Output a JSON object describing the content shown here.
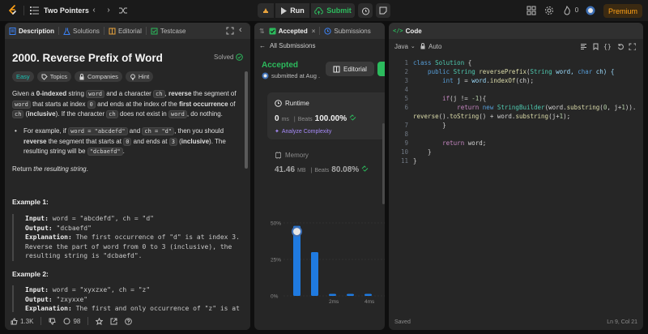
{
  "nav": {
    "title": "Two Pointers",
    "run_label": "Run",
    "submit_label": "Submit",
    "streak_count": "0",
    "premium_label": "Premium"
  },
  "description": {
    "tabs": [
      "Description",
      "Solutions",
      "Editorial",
      "Testcase"
    ],
    "title": "2000. Reverse Prefix of Word",
    "status": "Solved",
    "chips": [
      "Easy",
      "Topics",
      "Companies",
      "Hint"
    ],
    "p1": {
      "a": "Given a ",
      "b": "0-indexed",
      "c": " string ",
      "d": "word",
      "e": " and a character ",
      "f": "ch",
      "g": ", ",
      "h": "reverse",
      "i": " the segment of ",
      "j": "word",
      "k": " that starts at index ",
      "l": "0",
      "m": " and ends at the index of the ",
      "n": "first occurrence",
      "o": " of ",
      "p": "ch",
      "q": " (",
      "r": "inclusive",
      "s": "). If the character ",
      "t": "ch",
      "u": " does not exist in ",
      "v": "word",
      "w": ", do nothing."
    },
    "bullet": {
      "a": "For example, if ",
      "b": "word = \"abcdefd\"",
      "c": " and ",
      "d": "ch = \"d\"",
      "e": ", then you should ",
      "f": "reverse",
      "g": " the segment that starts at ",
      "h": "0",
      "i": " and ends at ",
      "j": "3",
      "k": " (",
      "l": "inclusive",
      "m": "). The resulting string will be ",
      "n": "\"dcbaefd\"",
      "o": "."
    },
    "return_pre": "Return ",
    "return_em": "the resulting string",
    "return_post": ".",
    "examples": [
      {
        "title": "Example 1:",
        "input_label": "Input:",
        "input": "word = \"abcdefd\", ch = \"d\"",
        "output_label": "Output:",
        "output": "\"dcbaefd\"",
        "explanation_label": "Explanation:",
        "explanation": "The first occurrence of \"d\" is at index 3.",
        "explanation2": "Reverse the part of word from 0 to 3 (inclusive), the",
        "explanation3": "resulting string is \"dcbaefd\"."
      },
      {
        "title": "Example 2:",
        "input_label": "Input:",
        "input": "word = \"xyxzxe\", ch = \"z\"",
        "output_label": "Output:",
        "output": "\"zxyxxe\"",
        "explanation_label": "Explanation:",
        "explanation": "The first and only occurrence of \"z\" is at"
      }
    ],
    "footer": {
      "likes": "1.3K",
      "comments": "98"
    }
  },
  "submission": {
    "tabs": [
      "Accepted",
      "Submissions"
    ],
    "all_submissions": "All Submissions",
    "status": "Accepted",
    "submitted_at": "submitted at Aug .",
    "editorial_label": "Editorial",
    "runtime": {
      "label": "Runtime",
      "value": "0",
      "unit": "ms",
      "beats_label": "Beats",
      "beats": "100.00%",
      "analyze": "Analyze Complexity"
    },
    "memory": {
      "label": "Memory",
      "value": "41.46",
      "unit": "MB",
      "beats_label": "Beats",
      "beats": "80.08%"
    },
    "chart_data": {
      "type": "bar",
      "y_ticks": [
        "50%",
        "25%",
        "0%"
      ],
      "x_ticks": [
        "2ms",
        "4ms"
      ],
      "ylim": [
        0,
        50
      ],
      "values": [
        48,
        30,
        1,
        1,
        1,
        1,
        1,
        1,
        1
      ]
    },
    "mini_chart_ticks": [
      "2ms",
      "4ms"
    ]
  },
  "code": {
    "tab": "Code",
    "language": "Java",
    "mode": "Auto",
    "lines": [
      "1",
      "2",
      "3",
      "4",
      "5",
      "6",
      "7",
      "8",
      "9",
      "10",
      "11"
    ],
    "src": {
      "l1a": "class ",
      "l1b": "Solution",
      "l1c": " {",
      "l2a": "    public ",
      "l2b": "String",
      "l2c": " reversePrefix",
      "l2d": "(",
      "l2e": "String",
      "l2f": " word, ",
      "l2g": "char",
      "l2h": " ch) {",
      "l3a": "        int ",
      "l3b": "j",
      "l3c": " = ",
      "l3d": "word",
      "l3e": ".",
      "l3f": "indexOf",
      "l3g": "(ch);",
      "l5a": "        if",
      "l5b": "(j != ",
      "l5c": "-1",
      "l5d": "){",
      "l6a": "            return ",
      "l6b": "new ",
      "l6c": "StringBuilder",
      "l6d": "(word.",
      "l6e": "substring",
      "l6f": "(",
      "l6g": "0",
      "l6h": ", j+",
      "l6i": "1",
      "l6j": ")).",
      "l6ka": "reverse",
      "l6kb": "().",
      "l6kc": "toString",
      "l6kd": "() + word.",
      "l6ke": "substring",
      "l6kf": "(j+",
      "l6kg": "1",
      "l6kh": ");",
      "l7": "        }",
      "l9a": "        return ",
      "l9b": "word;",
      "l10": "    }",
      "l11": "}"
    },
    "footer_left": "Saved",
    "footer_right": "Ln 9, Col 21"
  },
  "colors": {
    "accent": "#ffa116",
    "green": "#2cbb5d",
    "blue": "#1f7ae0"
  }
}
